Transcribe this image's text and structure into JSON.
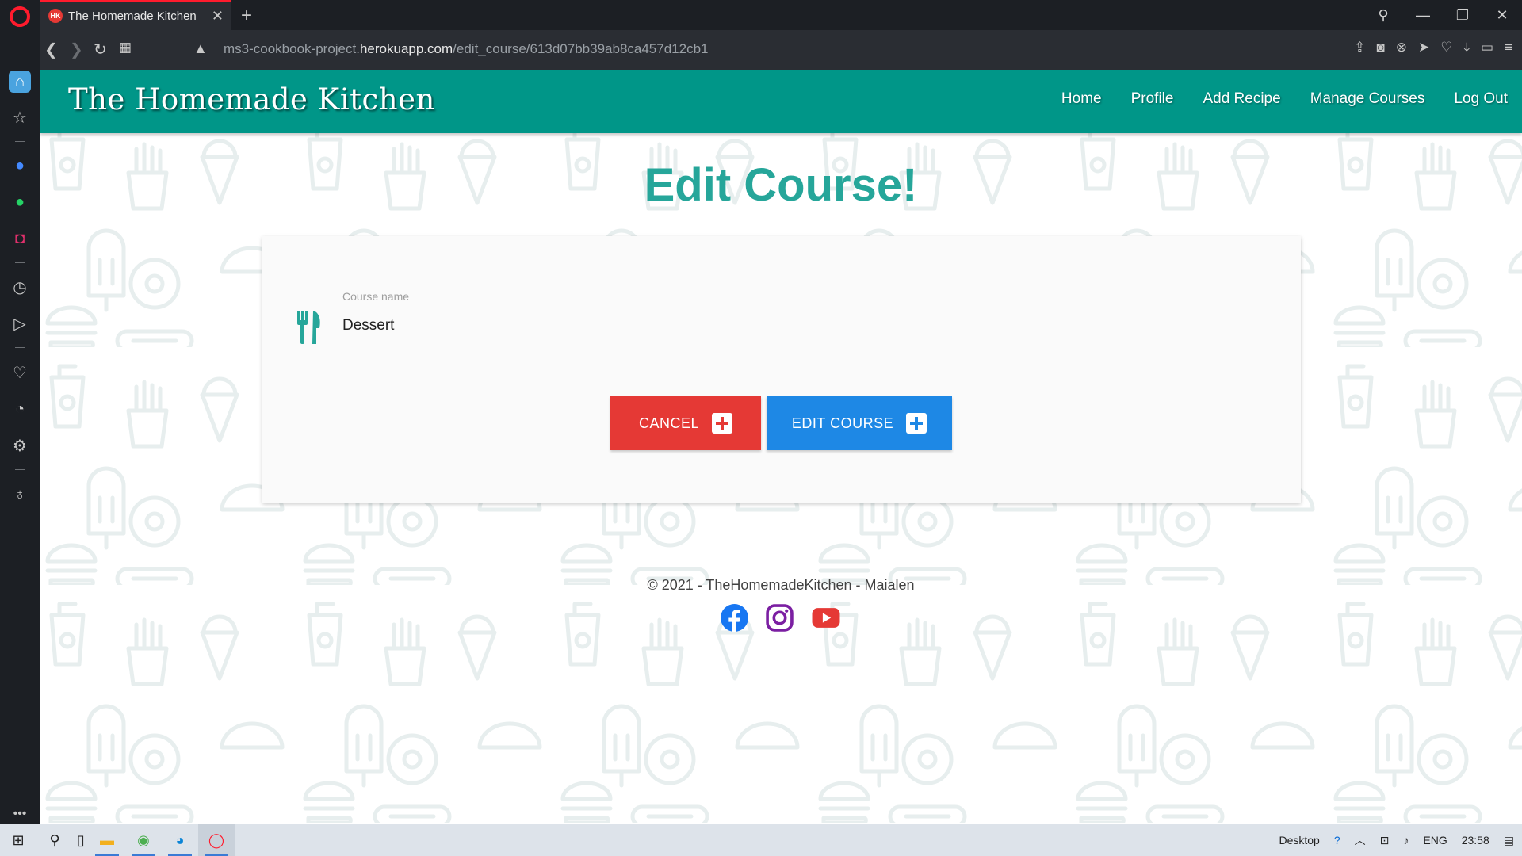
{
  "browser": {
    "tab_title": "The Homemade Kitchen",
    "tab_favicon_text": "HK",
    "url_prefix": "ms3-cookbook-project.",
    "url_domain": "herokuapp.com",
    "url_path": "/edit_course/613d07bb39ab8ca457d12cb1"
  },
  "site": {
    "brand": "The Homemade Kitchen",
    "nav": [
      "Home",
      "Profile",
      "Add Recipe",
      "Manage Courses",
      "Log Out"
    ],
    "page_title": "Edit Course!",
    "form": {
      "label": "Course name",
      "value": "Dessert",
      "cancel_label": "CANCEL",
      "submit_label": "EDIT COURSE"
    },
    "footer": "© 2021 - TheHomemadeKitchen - Maialen",
    "socials": [
      "facebook-icon",
      "instagram-icon",
      "youtube-icon"
    ]
  },
  "taskbar": {
    "desktop_label": "Desktop",
    "language": "ENG",
    "time": "23:58"
  },
  "colors": {
    "navbar": "#009688",
    "title": "#26a69a",
    "cancel": "#e53935",
    "submit": "#1e88e5"
  }
}
